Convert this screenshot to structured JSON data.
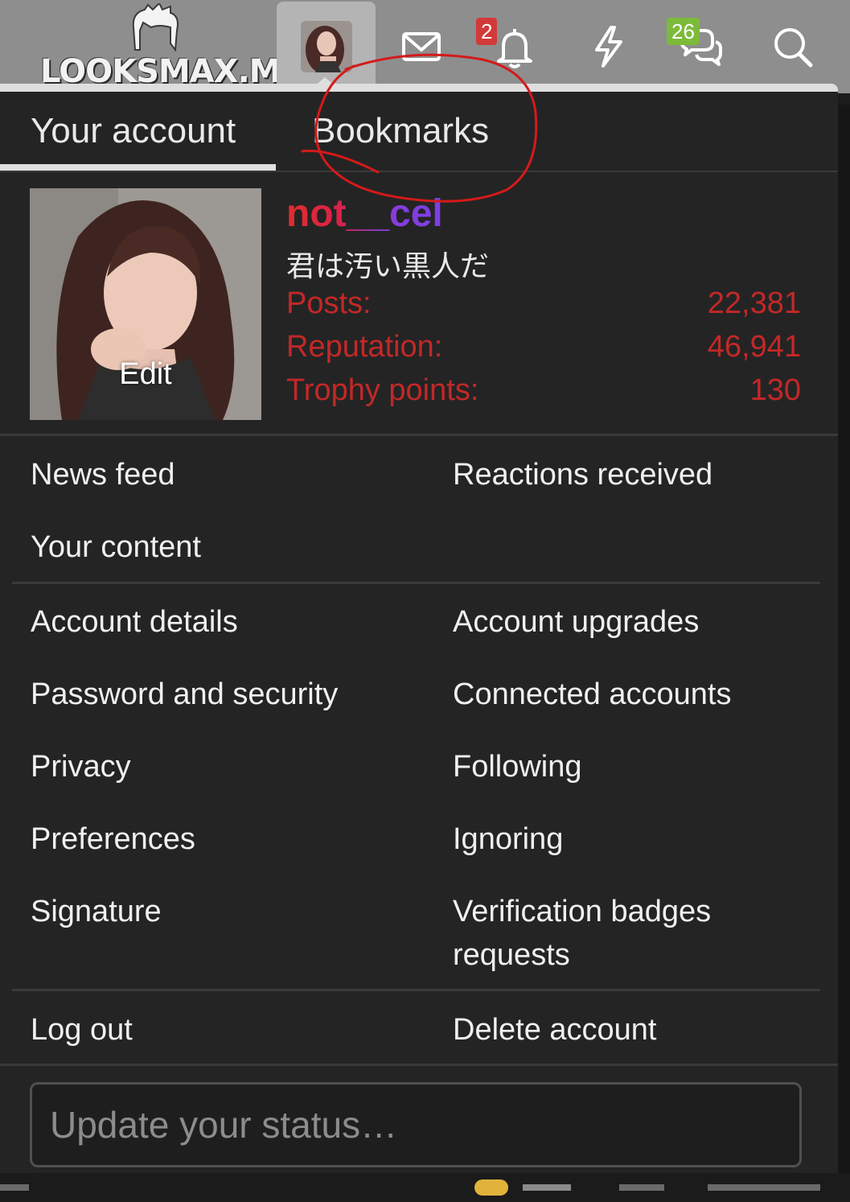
{
  "header": {
    "logo_text": "LOOKSMAX.ME",
    "icons": [
      "avatar-icon",
      "mail-icon",
      "bell-icon",
      "bolt-icon",
      "chat-icon",
      "search-icon"
    ],
    "alerts_badge": "2",
    "conversations_badge": "26"
  },
  "tabs": [
    {
      "label": "Your account",
      "active": true
    },
    {
      "label": "Bookmarks",
      "active": false
    }
  ],
  "profile": {
    "username": "not__cel",
    "user_title": "君は汚い黒人だ",
    "edit_label": "Edit",
    "stats": [
      {
        "label": "Posts:",
        "value": "22,381"
      },
      {
        "label": "Reputation:",
        "value": "46,941"
      },
      {
        "label": "Trophy points:",
        "value": "130"
      }
    ]
  },
  "links": {
    "group1": {
      "left": [
        "News feed",
        "Your content"
      ],
      "right": [
        "Reactions received"
      ]
    },
    "group2": {
      "left": [
        "Account details",
        "Password and security",
        "Privacy",
        "Preferences",
        "Signature"
      ],
      "right": [
        "Account upgrades",
        "Connected accounts",
        "Following",
        "Ignoring",
        "Verification badges",
        "requests"
      ]
    },
    "group3": {
      "left": [
        "Log out"
      ],
      "right": [
        "Delete account"
      ]
    }
  },
  "status": {
    "placeholder": "Update your status…"
  },
  "colors": {
    "stat_red": "#c32828",
    "username_gradient": [
      "#e02d2d",
      "#7b3fe4"
    ],
    "alert_badge": "#d23a3a",
    "conversation_badge": "#7dba3a",
    "annotation": "#d41a1a"
  }
}
